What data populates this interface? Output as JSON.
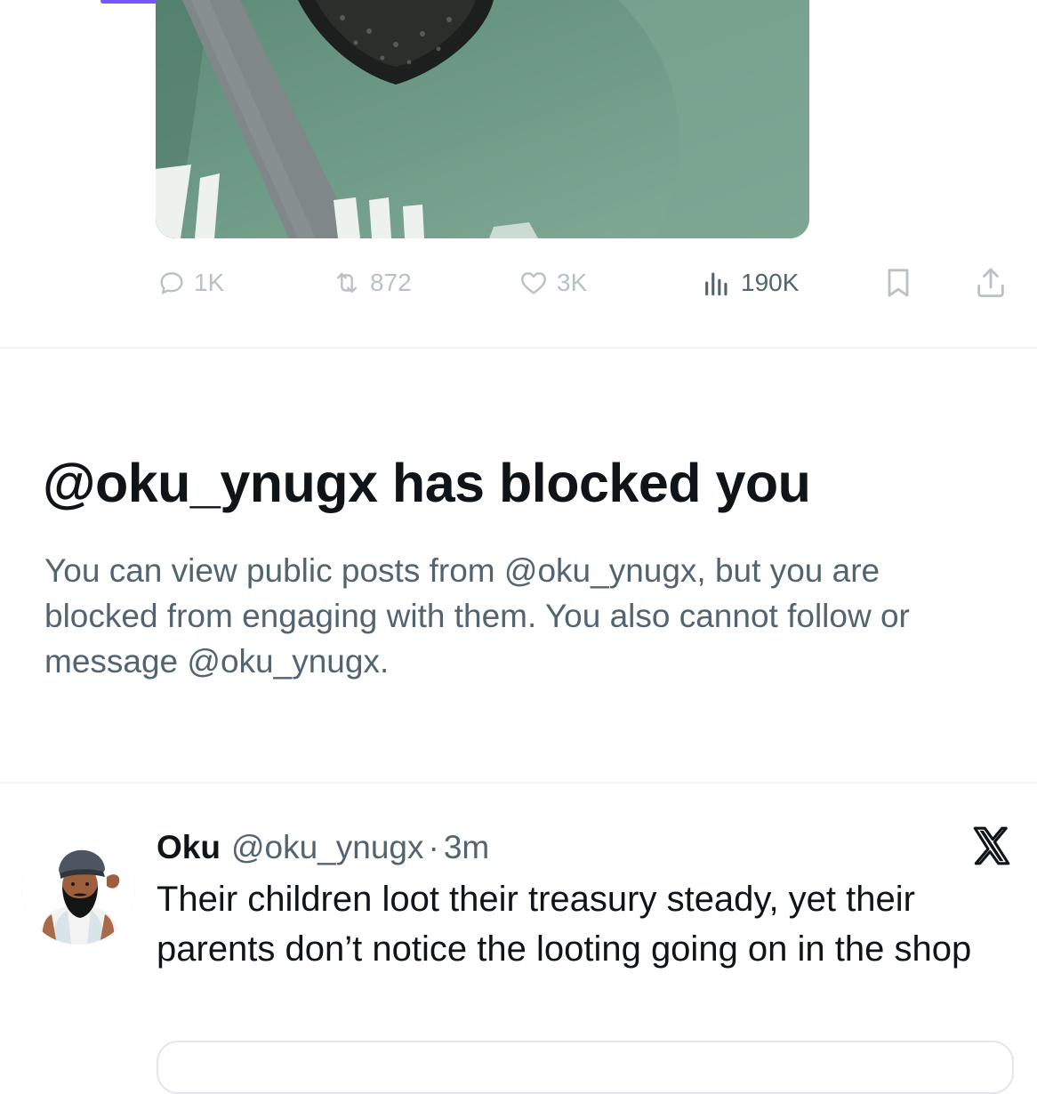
{
  "previous_post": {
    "media_alt": "video frame of person in green shirt with seatbelt",
    "actions": {
      "reply": {
        "icon": "reply-icon",
        "count": "1K"
      },
      "repost": {
        "icon": "repost-icon",
        "count": "872"
      },
      "like": {
        "icon": "heart-icon",
        "count": "3K"
      },
      "views": {
        "icon": "views-icon",
        "count": "190K"
      },
      "bookmark": {
        "icon": "bookmark-icon"
      },
      "share": {
        "icon": "share-icon"
      }
    }
  },
  "blocked_notice": {
    "title": "@oku_ynugx has blocked you",
    "description": "You can view public posts from @oku_ynugx, but you are blocked from engaging with them. You also cannot follow or message @oku_ynugx."
  },
  "post": {
    "author_name": "Oku",
    "author_handle": "@oku_ynugx",
    "separator": "·",
    "time": "3m",
    "text": "Their children loot their treasury steady, yet their parents don’t notice the looting going on in the shop",
    "badge_icon": "x-logo-icon"
  },
  "colors": {
    "text_primary": "#0f1419",
    "text_secondary": "#536471",
    "muted_icon": "#b9c1c8",
    "divider": "#eff3f4",
    "accent": "#7856ff"
  }
}
